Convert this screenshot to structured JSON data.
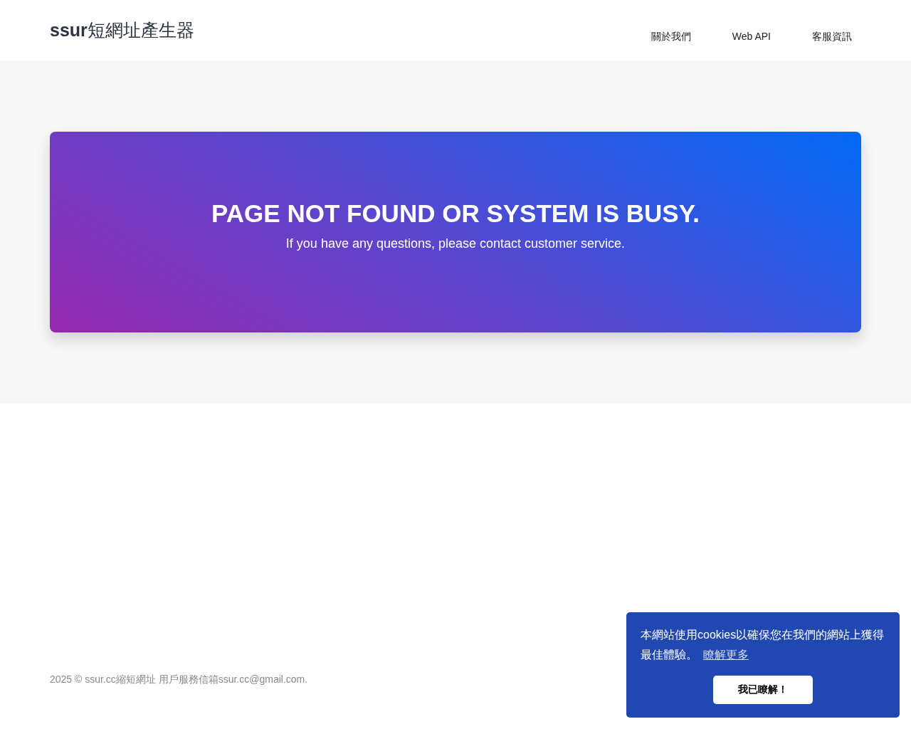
{
  "header": {
    "logo": "**ssur**短網址產生器",
    "nav": [
      "關於我們",
      "Web API",
      "客服資訊"
    ]
  },
  "hero": {
    "title": "PAGE NOT FOUND OR SYSTEM IS BUSY.",
    "subtitle": "If you have any questions, please contact customer service."
  },
  "footer": {
    "text": "2025 © ssur.cc縮短網址 用戶服務信箱ssur.cc@gmail.com."
  },
  "cookie_banner": {
    "message": "本網站使用cookies以確保您在我們的網站上獲得最佳體驗。",
    "link": "瞭解更多",
    "button": "我已瞭解！"
  }
}
